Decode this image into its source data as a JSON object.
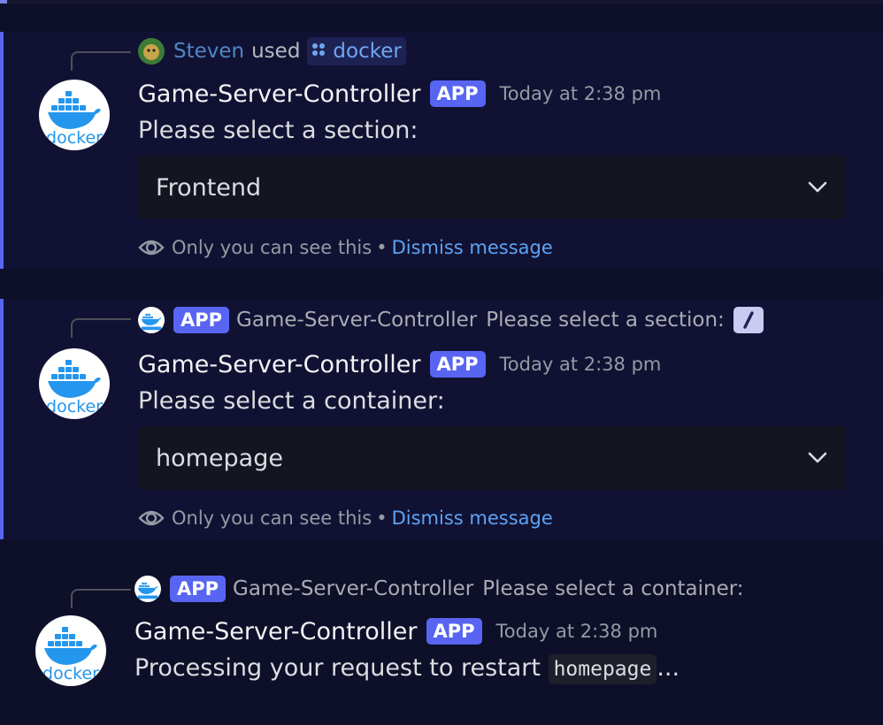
{
  "messages": [
    {
      "reply": {
        "user": "Steven",
        "used": "used",
        "command": "docker",
        "command_icon": "apps-icon"
      },
      "author": "Game-Server-Controller",
      "badge": "APP",
      "timestamp": "Today at 2:38 pm",
      "content": "Please select a section:",
      "select_value": "Frontend",
      "ephemeral": {
        "notice": "Only you can see this",
        "separator": "•",
        "dismiss": "Dismiss message"
      }
    },
    {
      "reply": {
        "badge": "APP",
        "author": "Game-Server-Controller",
        "text": "Please select a section:",
        "trailing_icon": "slash-command-icon"
      },
      "author": "Game-Server-Controller",
      "badge": "APP",
      "timestamp": "Today at 2:38 pm",
      "content": "Please select a container:",
      "select_value": "homepage",
      "ephemeral": {
        "notice": "Only you can see this",
        "separator": "•",
        "dismiss": "Dismiss message"
      }
    },
    {
      "reply": {
        "badge": "APP",
        "author": "Game-Server-Controller",
        "text": "Please select a container:"
      },
      "author": "Game-Server-Controller",
      "badge": "APP",
      "timestamp": "Today at 2:38 pm",
      "content_before": "Processing your request to restart",
      "content_code": "homepage",
      "content_after": "..."
    }
  ],
  "colors": {
    "background": "#0e0f29",
    "highlight_bar": "#5865f2",
    "app_badge": "#5865f2",
    "link": "#5da3f5",
    "username": "#4f86c5"
  },
  "avatar": {
    "label": "docker"
  }
}
